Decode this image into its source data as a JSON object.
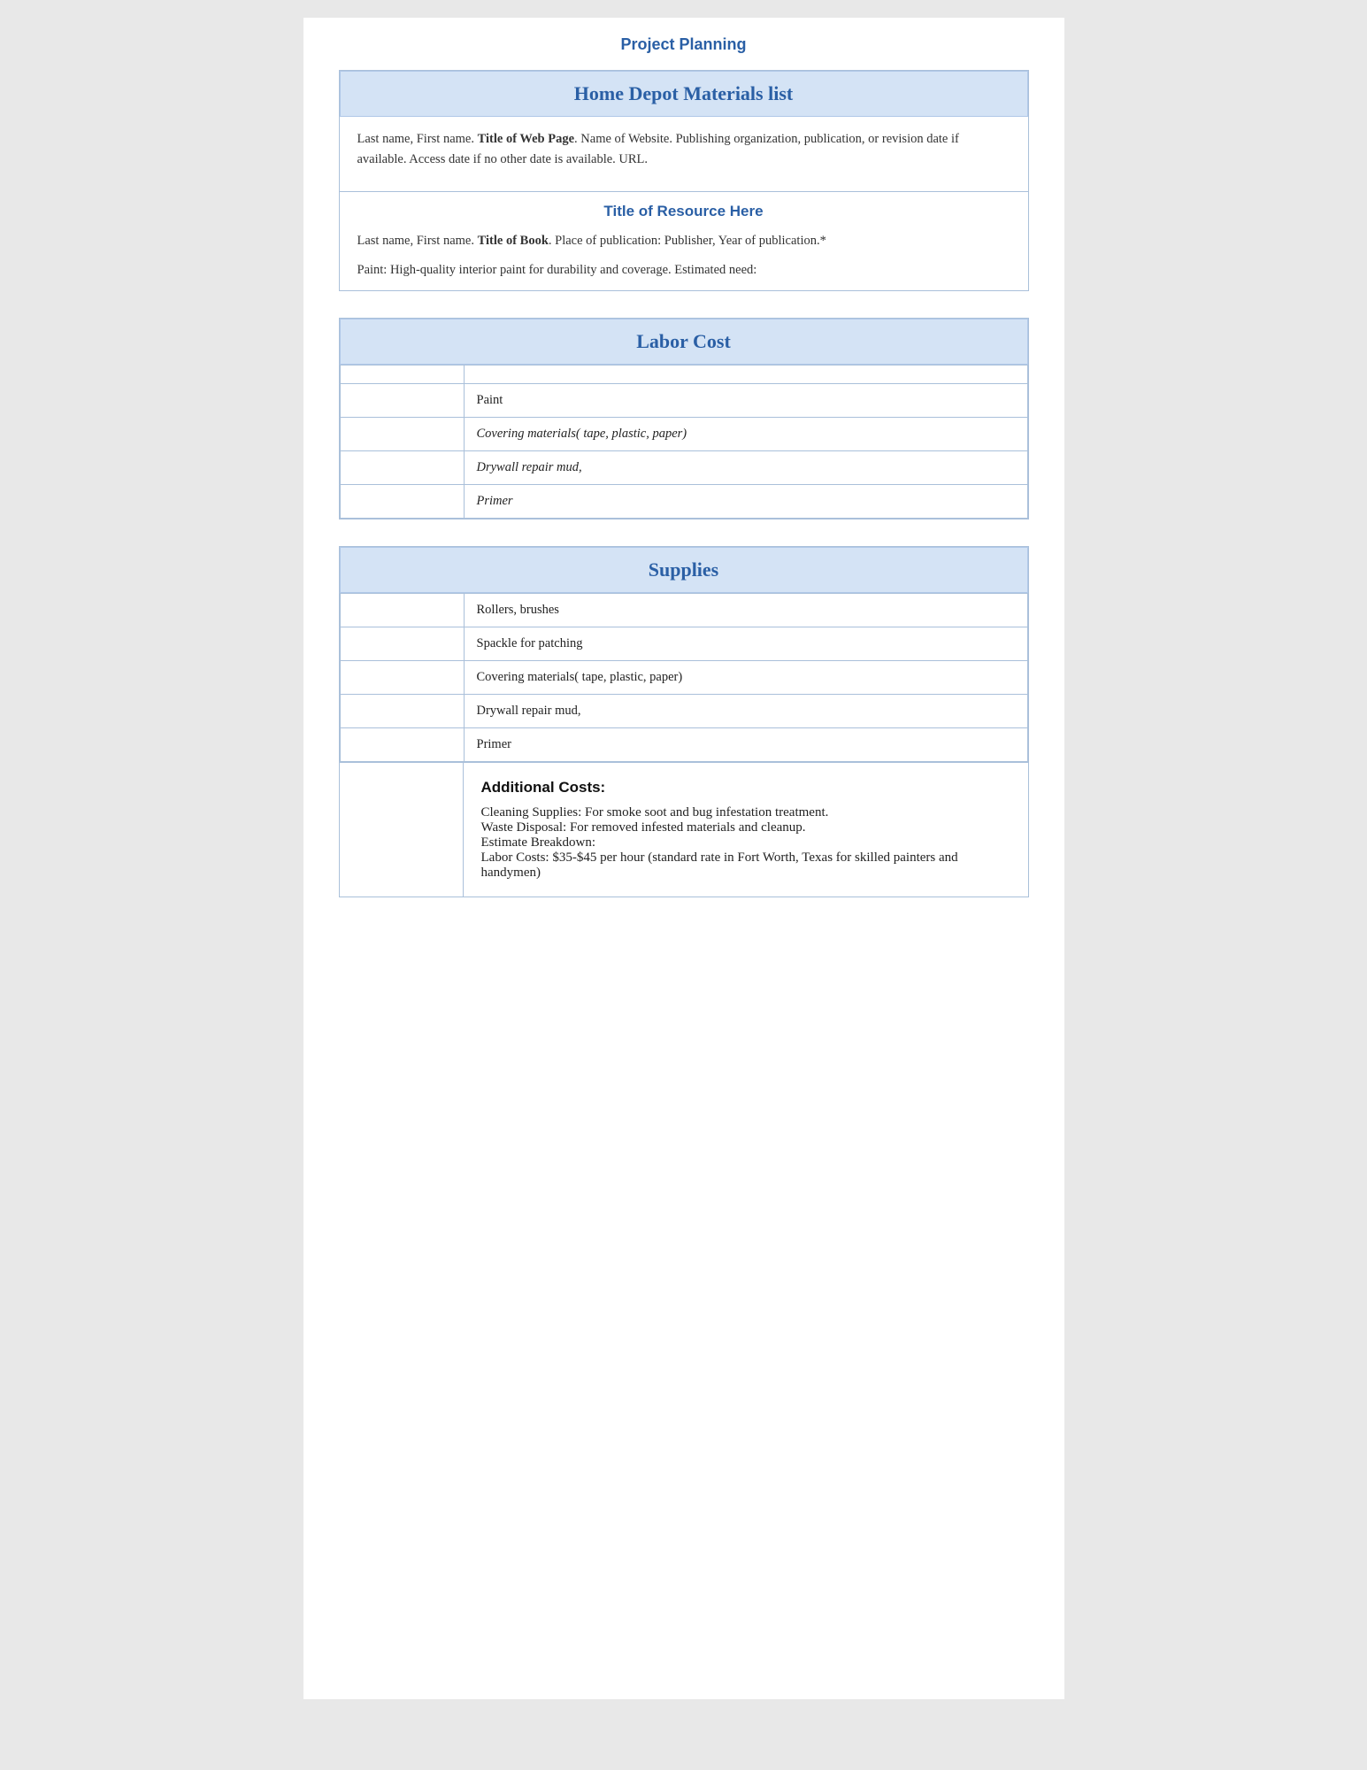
{
  "page": {
    "title": "Project Planning"
  },
  "materials_section": {
    "header": "Home Depot Materials list",
    "citation": {
      "text_before_bold": "Last name, First name. ",
      "bold_text": "Title of Web Page",
      "text_after_bold": ". Name of Website. Publishing organization, publication, or revision date if available. Access date if no other date is available. URL."
    },
    "resource_title": "Title of Resource Here",
    "book_citation": {
      "text_before_bold": "Last name, First name. ",
      "bold_text": "Title of Book",
      "text_after_bold": ". Place of publication: Publisher, Year of publication.*"
    },
    "paint_note": "Paint: High-quality interior paint for durability and coverage. Estimated need:"
  },
  "labor_cost_section": {
    "header": "Labor Cost",
    "rows": [
      {
        "left": "",
        "right": "",
        "italic": false
      },
      {
        "left": "",
        "right": "Paint",
        "italic": false
      },
      {
        "left": "",
        "right": "Covering materials( tape, plastic, paper)",
        "italic": true
      },
      {
        "left": "",
        "right": "Drywall repair mud,",
        "italic": true
      },
      {
        "left": "",
        "right": "Primer",
        "italic": true
      }
    ]
  },
  "supplies_section": {
    "header": "Supplies",
    "rows": [
      {
        "left": "",
        "right": "Rollers, brushes",
        "italic": false
      },
      {
        "left": "",
        "right": "Spackle for patching",
        "italic": false
      },
      {
        "left": "",
        "right": "Covering materials( tape, plastic, paper)",
        "italic": false
      },
      {
        "left": "",
        "right": "Drywall repair mud,",
        "italic": false
      },
      {
        "left": "",
        "right": "Primer",
        "italic": false
      }
    ]
  },
  "additional_costs": {
    "title": "Additional Costs:",
    "items": [
      "Cleaning Supplies: For smoke soot and bug infestation treatment.",
      "Waste Disposal: For removed infested materials and cleanup.",
      "Estimate Breakdown:",
      "Labor Costs:  $35-$45 per hour (standard rate in Fort Worth, Texas for skilled painters and handymen)"
    ]
  }
}
